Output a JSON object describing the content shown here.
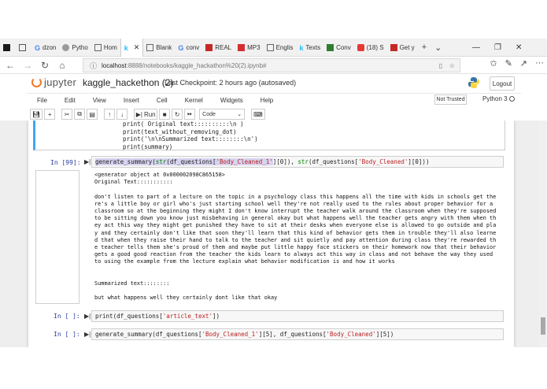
{
  "browser": {
    "tabs": [
      {
        "label": "",
        "color": "#1a1a1a"
      },
      {
        "label": "",
        "color": "#555555"
      },
      {
        "label": "dzon",
        "color": "#4285f4"
      },
      {
        "label": "Pytho",
        "color": "#888888"
      },
      {
        "label": "Hom",
        "color": "#666666"
      },
      {
        "label": "k",
        "color": "#20beff"
      },
      {
        "label": "Blank",
        "color": "#666666"
      },
      {
        "label": "conv",
        "color": "#4285f4"
      },
      {
        "label": "REAL",
        "color": "#c62828"
      },
      {
        "label": "MP3",
        "color": "#d32f2f"
      },
      {
        "label": "Englis",
        "color": "#666666"
      },
      {
        "label": "Texts",
        "color": "#20beff"
      },
      {
        "label": "Conv",
        "color": "#2e7d32"
      },
      {
        "label": "(18) S",
        "color": "#e53935"
      },
      {
        "label": "Get y",
        "color": "#c62828"
      }
    ],
    "new_tab": "+",
    "tab_menu": "⌄",
    "url_host": "localhost",
    "url_path": ":8888/notebooks/kaggle_hackathon%20(2).ipynb#"
  },
  "jupyter": {
    "logo_text": "jupyter",
    "notebook_name": "kaggle_hackethon (2)",
    "checkpoint": "Last Checkpoint: 2 hours ago",
    "autosave": "(autosaved)",
    "logout": "Logout",
    "menu": [
      "File",
      "Edit",
      "View",
      "Insert",
      "Cell",
      "Kernel",
      "Widgets",
      "Help"
    ],
    "trust": "Not Trusted",
    "kernel": "Python 3",
    "run_label": "Run",
    "cell_type": "Code"
  },
  "cells": {
    "prev_code": "    print( Original text::::::::::\\n )\n    print(text_without_removing_dot)\n    print('\\n\\nSummarized text::::::::\\n')\n    print(summary)",
    "cell99_prompt": "In [99]:",
    "cell99_fn": "generate_summary",
    "cell99_pre": "(",
    "cell99_str": "str",
    "cell99_mid1": "(df_questions[",
    "cell99_s1": "'Body_Cleaned_1'",
    "cell99_mid2": "][0]), ",
    "cell99_str2": "str",
    "cell99_mid3": "(df_questions[",
    "cell99_s2": "'Body_Cleaned'",
    "cell99_end": "][0]))",
    "output": "<generator object at 0x000002098C865158>\nOriginal Text:::::::::::\n\ndon't listen to part of a lecture on the topic in a psychology class this happens all the time with kids in schools get the\nre's a little boy or girl who's just starting school well they're not really used to the rules about proper behavior for a\nclassroom so at the beginning they might I don't know interrupt the teacher walk around the classroom when they're supposed\nto be sitting down you know just misbehaving in general okay but what happens well the teacher gets angry with them when th\ney act this way they might get punished they have to sit at their desks when everyone else is allowed to go outside and pla\ny and they certainly don't like that soon they'll learn that this kind of behavior gets them in trouble they'll also learne\nd that when they raise their hand to talk to the teacher and sit quietly and pay attention during class they're rewarded th\ne teacher tells them she's proud of them and maybe put little happy face stickers on their homework now that their behavior\ngets a good good reaction from the teacher the kids learn to always act this way in class and not behave the way they used\nto using the example from the lecture explain what behavior modification is and how it works\n\n\nSummarized text::::::::\n\nbut what happens well they certainly dont like that okay",
    "cell_a_prompt": "In [ ]:",
    "cell_a_pre": "print(df_questions[",
    "cell_a_str": "'article_text'",
    "cell_a_end": "])",
    "cell_b_prompt": "In [ ]:",
    "cell_b_pre": "generate_summary(df_questions[",
    "cell_b_s1": "'Body_Cleaned_1'",
    "cell_b_mid": "][5], df_questions[",
    "cell_b_s2": "'Body_Cleaned'",
    "cell_b_end": "][5])"
  }
}
